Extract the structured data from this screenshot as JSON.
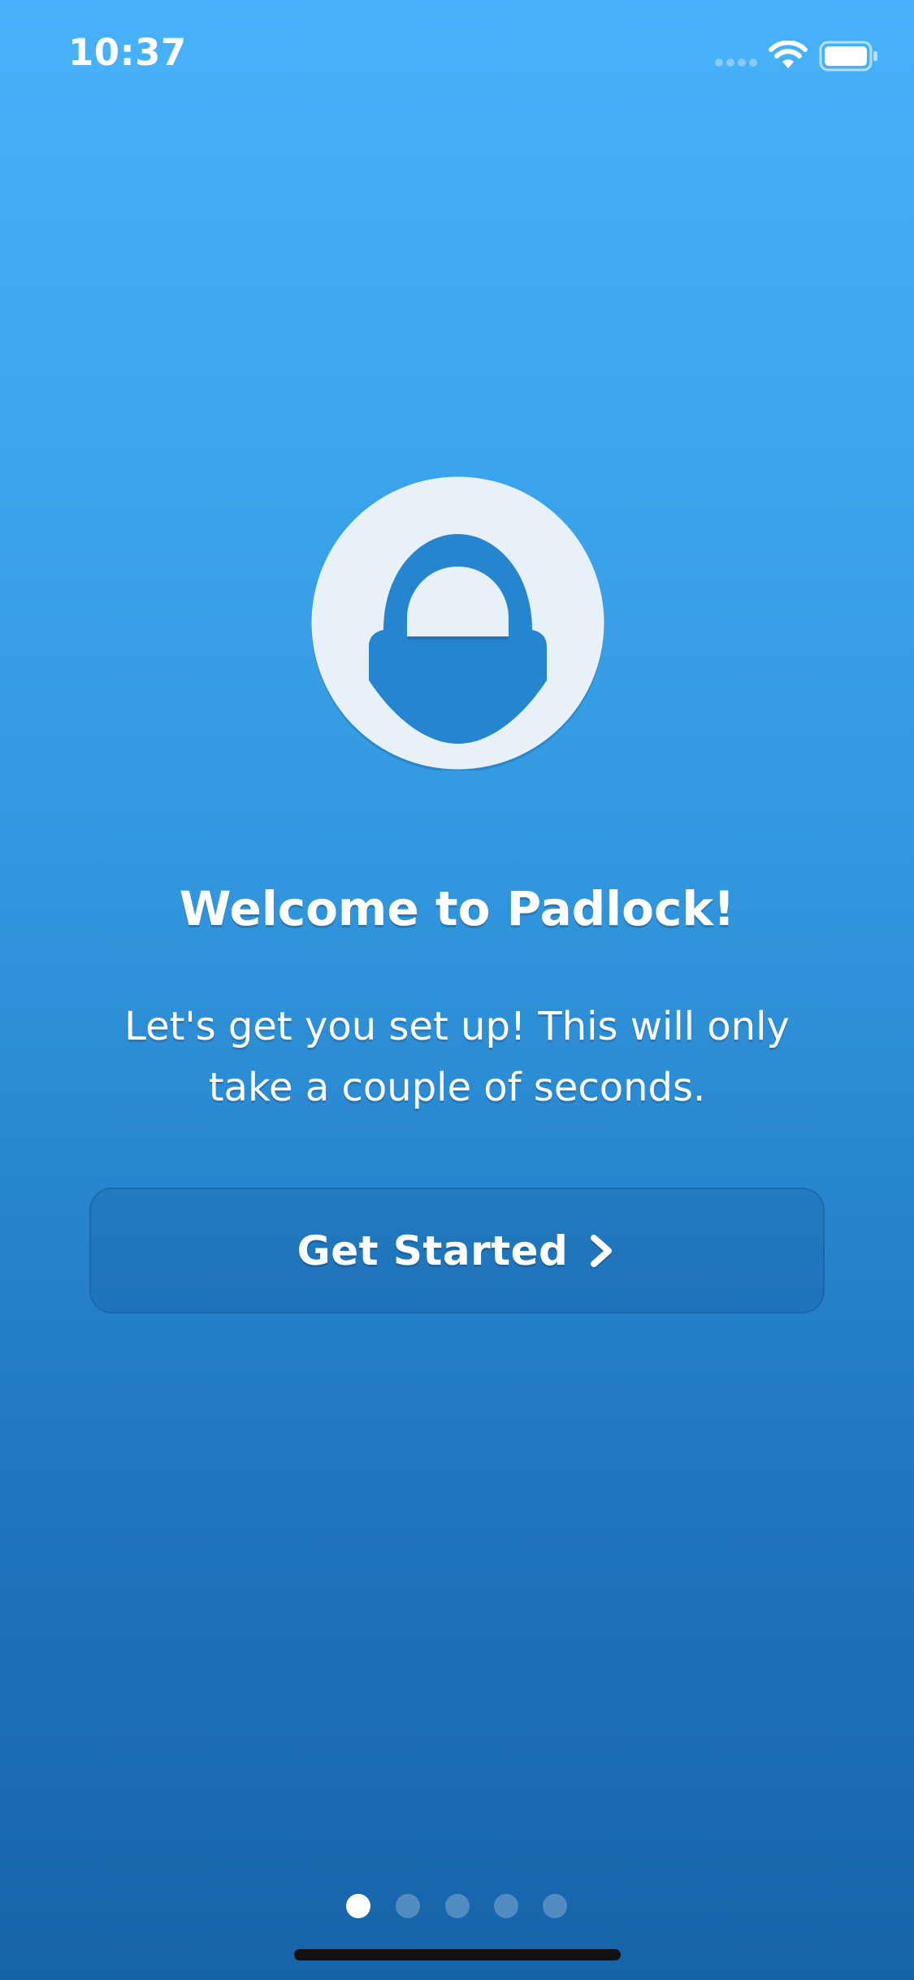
{
  "status_bar": {
    "time": "10:37"
  },
  "logo": {
    "icon": "padlock-logo-icon"
  },
  "welcome": {
    "title": "Welcome to Padlock!",
    "text_line1": "Let's get you set up! This will only",
    "text_line2": "take a couple of seconds."
  },
  "actions": {
    "get_started_label": "Get Started"
  },
  "pagination": {
    "total": 5,
    "active_index": 0
  },
  "colors": {
    "gradient_top": "#47b2fb",
    "gradient_bottom": "#1663a9",
    "logo_fill": "#e8f1f8"
  }
}
